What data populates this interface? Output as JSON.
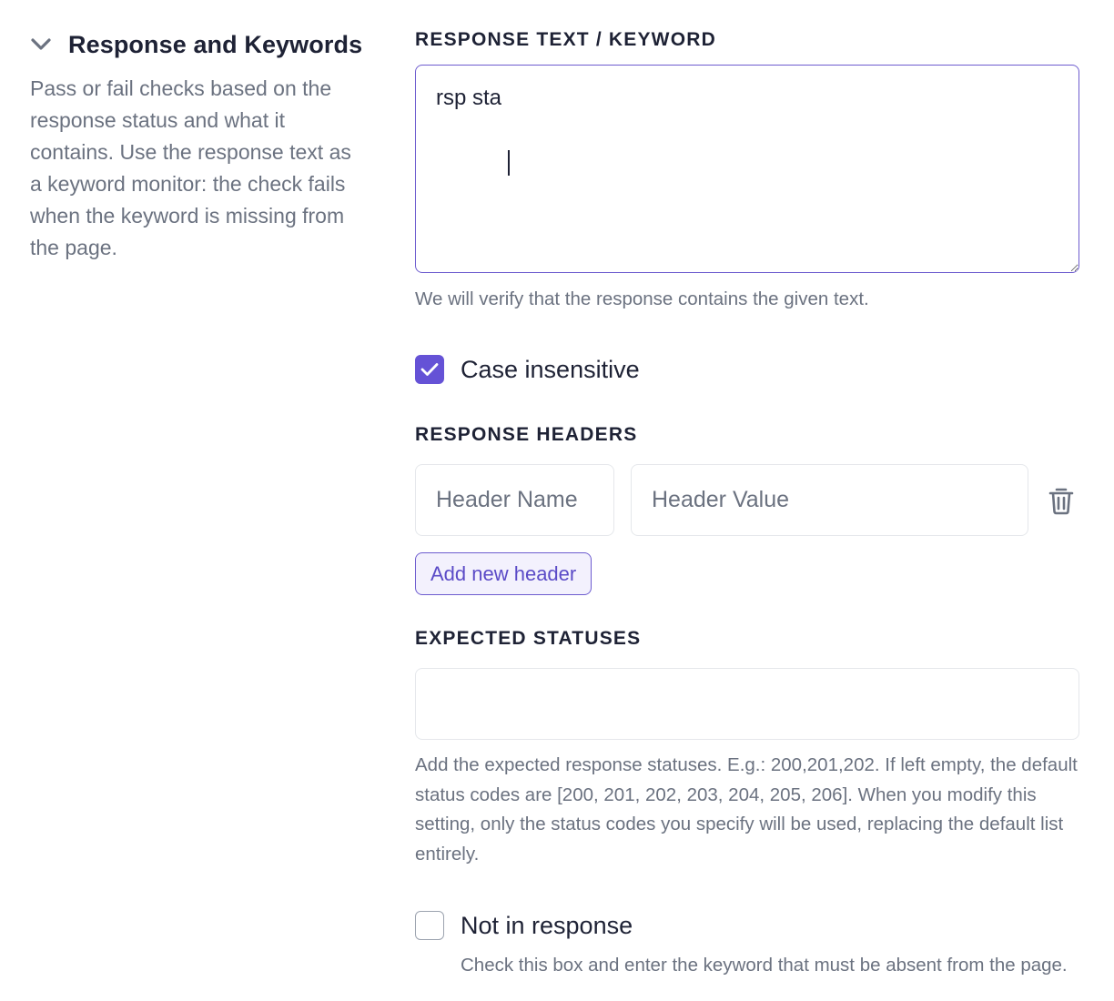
{
  "section": {
    "title": "Response and Keywords",
    "description": "Pass or fail checks based on the response status and what it contains. Use the response text as a keyword monitor: the check fails when the keyword is missing from the page."
  },
  "response_text": {
    "label": "RESPONSE TEXT / KEYWORD",
    "value": "rsp sta",
    "helper": "We will verify that the response contains the given text."
  },
  "case_insensitive": {
    "label": "Case insensitive",
    "checked": true
  },
  "response_headers": {
    "label": "RESPONSE HEADERS",
    "name_placeholder": "Header Name",
    "value_placeholder": "Header Value",
    "add_label": "Add new header"
  },
  "expected_statuses": {
    "label": "EXPECTED STATUSES",
    "value": "",
    "helper": "Add the expected response statuses. E.g.: 200,201,202. If left empty, the default status codes are [200, 201, 202, 203, 204, 205, 206]. When you modify this setting, only the status codes you specify will be used, replacing the default list entirely."
  },
  "not_in_response": {
    "label": "Not in response",
    "checked": false,
    "helper": "Check this box and enter the keyword that must be absent from the page."
  },
  "icons": {
    "collapse": "chevron-down-icon",
    "check": "check-icon",
    "delete": "trash-icon"
  },
  "colors": {
    "accent": "#6552d6",
    "text": "#1e2235",
    "muted": "#6b7280"
  }
}
